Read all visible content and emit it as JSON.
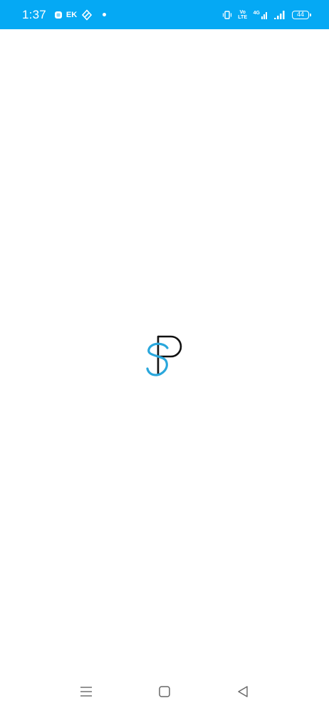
{
  "status_bar": {
    "time": "1:37",
    "carrier": "EK",
    "network_type": "4G",
    "volte_label": "Vo LTE",
    "battery_level": "44",
    "background": "#05a9f4"
  },
  "logo": {
    "letters": [
      "S",
      "P"
    ],
    "colors": {
      "S": "#2aa7dc",
      "P": "#111111"
    }
  },
  "nav_bar": {
    "items": [
      "menu-icon",
      "home-icon",
      "back-icon"
    ]
  }
}
